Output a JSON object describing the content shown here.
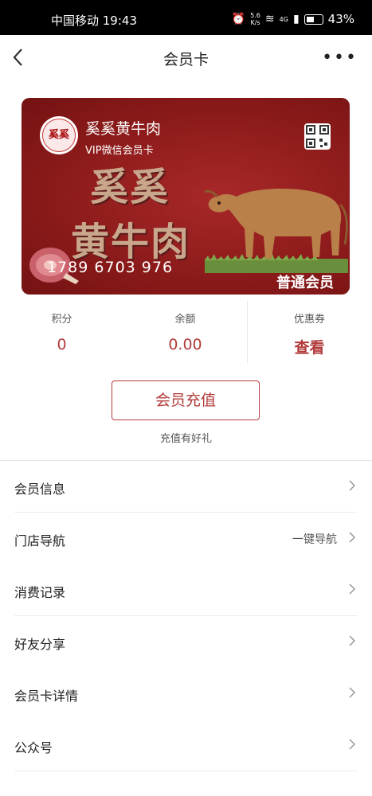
{
  "status_bar": {
    "carrier_time": "中国移动 19:43",
    "net_speed_value": "5.6",
    "net_speed_unit": "K/s",
    "network": "4G",
    "battery": "43%"
  },
  "nav": {
    "title": "会员卡",
    "more": "•••"
  },
  "card": {
    "store_name": "奚奚黄牛肉",
    "subtitle": "VIP微信会员卡",
    "logo_text": "奚奚",
    "art_line1": "奚奚",
    "art_line2": "黄牛肉",
    "number": "1789 6703 976",
    "level": "普通会员"
  },
  "stats": [
    {
      "label": "积分",
      "value": "0"
    },
    {
      "label": "余额",
      "value": "0.00"
    },
    {
      "label": "优惠券",
      "value": "查看"
    }
  ],
  "recharge": {
    "button": "会员充值",
    "hint": "充值有好礼"
  },
  "menu": [
    {
      "label": "会员信息",
      "extra": ""
    },
    {
      "label": "门店导航",
      "extra": "一键导航"
    },
    {
      "label": "消费记录",
      "extra": ""
    },
    {
      "label": "好友分享",
      "extra": ""
    },
    {
      "label": "会员卡详情",
      "extra": ""
    },
    {
      "label": "公众号",
      "extra": ""
    }
  ],
  "colors": {
    "accent": "#b23a3a",
    "card_bg": "#8d1b1b"
  }
}
